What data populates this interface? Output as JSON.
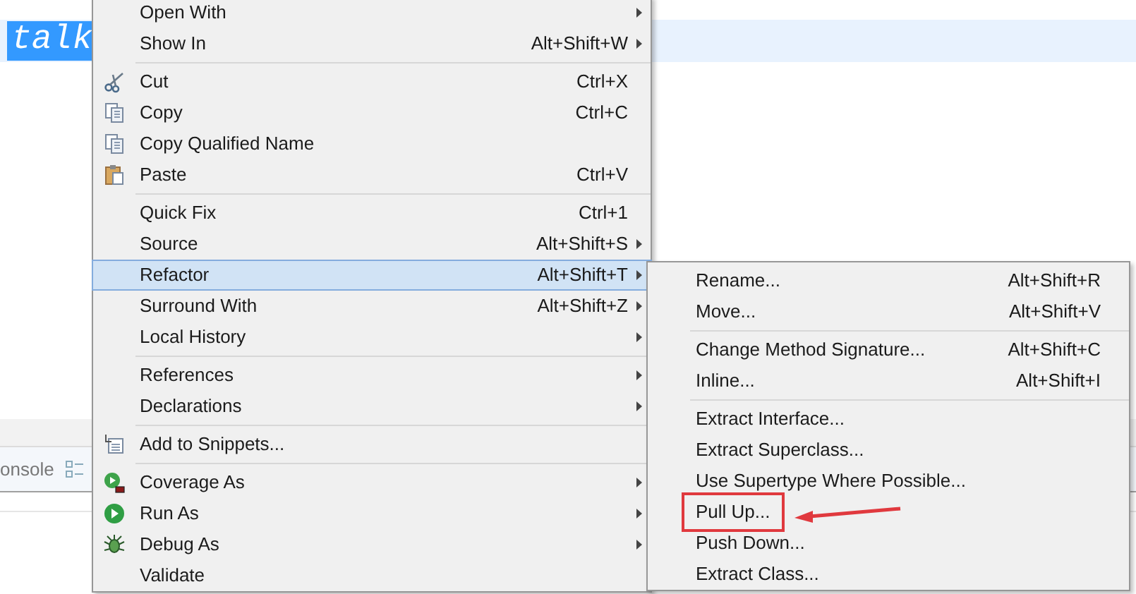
{
  "editor": {
    "selected_text": "talk"
  },
  "console_tab": {
    "label": "onsole"
  },
  "context_menu": {
    "items": [
      {
        "kind": "item",
        "label": "Open With",
        "has_submenu": true,
        "selected": false
      },
      {
        "kind": "item",
        "label": "Show In",
        "shortcut": "Alt+Shift+W",
        "has_submenu": true,
        "selected": false
      },
      {
        "kind": "separator"
      },
      {
        "kind": "item",
        "label": "Cut",
        "shortcut": "Ctrl+X",
        "has_submenu": false,
        "selected": false
      },
      {
        "kind": "item",
        "label": "Copy",
        "shortcut": "Ctrl+C",
        "has_submenu": false,
        "selected": false
      },
      {
        "kind": "item",
        "label": "Copy Qualified Name",
        "has_submenu": false,
        "selected": false
      },
      {
        "kind": "item",
        "label": "Paste",
        "shortcut": "Ctrl+V",
        "has_submenu": false,
        "selected": false
      },
      {
        "kind": "separator"
      },
      {
        "kind": "item",
        "label": "Quick Fix",
        "shortcut": "Ctrl+1",
        "has_submenu": false,
        "selected": false
      },
      {
        "kind": "item",
        "label": "Source",
        "shortcut": "Alt+Shift+S",
        "has_submenu": true,
        "selected": false
      },
      {
        "kind": "item",
        "label": "Refactor",
        "shortcut": "Alt+Shift+T",
        "has_submenu": true,
        "selected": true
      },
      {
        "kind": "item",
        "label": "Surround With",
        "shortcut": "Alt+Shift+Z",
        "has_submenu": true,
        "selected": false
      },
      {
        "kind": "item",
        "label": "Local History",
        "has_submenu": true,
        "selected": false
      },
      {
        "kind": "separator"
      },
      {
        "kind": "item",
        "label": "References",
        "has_submenu": true,
        "selected": false
      },
      {
        "kind": "item",
        "label": "Declarations",
        "has_submenu": true,
        "selected": false
      },
      {
        "kind": "separator"
      },
      {
        "kind": "item",
        "label": "Add to Snippets...",
        "has_submenu": false,
        "selected": false
      },
      {
        "kind": "separator"
      },
      {
        "kind": "item",
        "label": "Coverage As",
        "has_submenu": true,
        "selected": false
      },
      {
        "kind": "item",
        "label": "Run As",
        "has_submenu": true,
        "selected": false
      },
      {
        "kind": "item",
        "label": "Debug As",
        "has_submenu": true,
        "selected": false
      },
      {
        "kind": "item",
        "label": "Validate",
        "has_submenu": false,
        "selected": false
      }
    ]
  },
  "refactor_submenu": {
    "items": [
      {
        "kind": "item",
        "label": "Rename...",
        "shortcut": "Alt+Shift+R",
        "boxed": false
      },
      {
        "kind": "item",
        "label": "Move...",
        "shortcut": "Alt+Shift+V",
        "boxed": false
      },
      {
        "kind": "separator"
      },
      {
        "kind": "item",
        "label": "Change Method Signature...",
        "shortcut": "Alt+Shift+C",
        "boxed": false
      },
      {
        "kind": "item",
        "label": "Inline...",
        "shortcut": "Alt+Shift+I",
        "boxed": false
      },
      {
        "kind": "separator"
      },
      {
        "kind": "item",
        "label": "Extract Interface...",
        "boxed": false
      },
      {
        "kind": "item",
        "label": "Extract Superclass...",
        "boxed": false
      },
      {
        "kind": "item",
        "label": "Use Supertype Where Possible...",
        "boxed": false
      },
      {
        "kind": "item",
        "label": "Pull Up...",
        "boxed": true
      },
      {
        "kind": "item",
        "label": "Push Down...",
        "boxed": false
      },
      {
        "kind": "item",
        "label": "Extract Class...",
        "boxed": false
      }
    ]
  }
}
